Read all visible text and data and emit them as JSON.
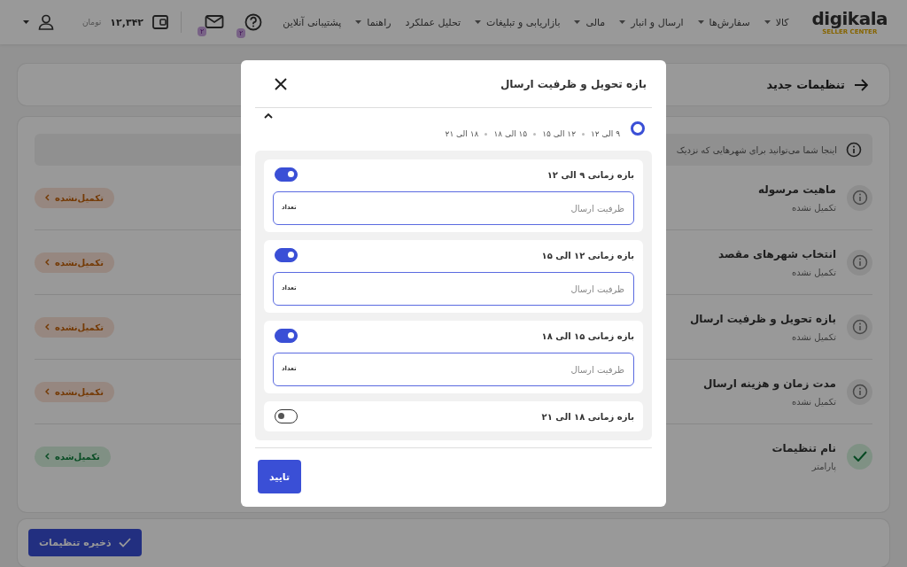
{
  "header": {
    "logo": "digikala",
    "logo_sub": "SELLER CENTER",
    "nav": [
      {
        "label": "کالا",
        "dropdown": true
      },
      {
        "label": "سفارش‌ها",
        "dropdown": true
      },
      {
        "label": "ارسال و انبار",
        "dropdown": true
      },
      {
        "label": "مالی",
        "dropdown": true
      },
      {
        "label": "بازاریابی و تبلیغات",
        "dropdown": true
      },
      {
        "label": "تحلیل عملکرد",
        "dropdown": false
      },
      {
        "label": "راهنما",
        "dropdown": true
      },
      {
        "label": "پشتیبانی آنلاین",
        "dropdown": false
      }
    ],
    "help_badge": "۲",
    "mail_badge": "۲",
    "balance": "۱۲,۳۴۲",
    "currency": "تومان"
  },
  "page": {
    "title": "تنظیمات جدید",
    "info": "اینجا شما می‌توانید برای شهرهایی که نزدیک",
    "steps": [
      {
        "title": "ماهیت مرسوله",
        "subtitle": "تکمیل نشده",
        "status": "تکمیل‌نشده",
        "done": false
      },
      {
        "title": "انتخاب شهرهای مقصد",
        "subtitle": "تکمیل نشده",
        "status": "تکمیل‌نشده",
        "done": false
      },
      {
        "title": "بازه تحویل و ظرفیت ارسال",
        "subtitle": "تکمیل نشده",
        "status": "تکمیل‌نشده",
        "done": false
      },
      {
        "title": "مدت زمان و هزینه ارسال",
        "subtitle": "تکمیل نشده",
        "status": "تکمیل‌نشده",
        "done": false
      },
      {
        "title": "نام تنظیمات",
        "subtitle": "پارامتر",
        "status": "تکمیل‌شده",
        "done": true
      }
    ],
    "save_button": "ذخیره تنظیمات"
  },
  "modal": {
    "title": "بازه تحویل و ظرفیت ارسال",
    "option": {
      "selected": true,
      "expanded": true,
      "summary": [
        "۹ الی ۱۲",
        "۱۲ الی ۱۵",
        "۱۵ الی ۱۸",
        "۱۸ الی ۲۱"
      ]
    },
    "slots": [
      {
        "title": "بازه زمانی ۹ الی ۱۲",
        "on": true,
        "placeholder": "ظرفیت ارسال",
        "unit": "تعداد"
      },
      {
        "title": "بازه زمانی ۱۲ الی ۱۵",
        "on": true,
        "placeholder": "ظرفیت ارسال",
        "unit": "تعداد"
      },
      {
        "title": "بازه زمانی ۱۵ الی ۱۸",
        "on": true,
        "placeholder": "ظرفیت ارسال",
        "unit": "تعداد"
      },
      {
        "title": "بازه زمانی ۱۸ الی ۲۱",
        "on": false
      }
    ],
    "confirm": "تایید"
  }
}
